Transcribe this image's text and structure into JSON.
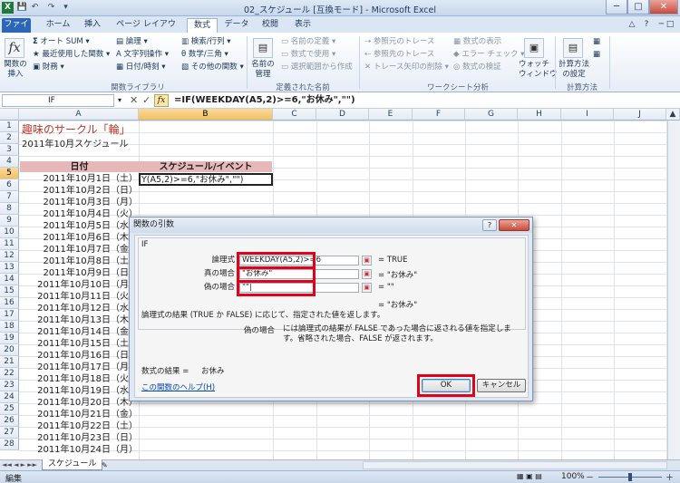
{
  "window": {
    "title": "02_スケジュール [互換モード] - Microsoft Excel",
    "controls": {
      "minimize": "─",
      "maximize": "□",
      "close": "✕"
    }
  },
  "qat": [
    "💾",
    "↶",
    "↷",
    "▾"
  ],
  "tabs": [
    "ファイル",
    "ホーム",
    "挿入",
    "ページ レイアウト",
    "数式",
    "データ",
    "校閲",
    "表示"
  ],
  "ribbon": {
    "insert_function": "関数の\n挿入",
    "library": {
      "autosum": "オート SUM",
      "recent": "最近使用した関数",
      "finance": "財務",
      "logical": "論理",
      "text": "文字列操作",
      "datetime": "日付/時刻",
      "lookup": "検索/行列",
      "math": "数学/三角",
      "other": "その他の関数",
      "group_label": "関数ライブラリ"
    },
    "names": {
      "manager": "名前の\n管理",
      "define": "名前の定義",
      "use": "数式で使用",
      "create": "選択範囲から作成",
      "group_label": "定義された名前"
    },
    "audit": {
      "trace_prec": "参照元のトレース",
      "trace_dep": "参照先のトレース",
      "remove_arrows": "トレース矢印の削除",
      "show_formulas": "数式の表示",
      "error_check": "エラー チェック",
      "evaluate": "数式の検証",
      "watch": "ウォッチ\nウィンドウ",
      "group_label": "ワークシート分析"
    },
    "calc": {
      "options": "計算方法\nの設定",
      "group_label": "計算方法"
    }
  },
  "formula_bar": {
    "name_box": "IF",
    "formula": "=IF(WEEKDAY(A5,2)>=6,\"お休み\",\"\")",
    "fx": "fx"
  },
  "columns": [
    "A",
    "B",
    "C",
    "D",
    "E",
    "F",
    "G",
    "H",
    "I",
    "J"
  ],
  "rows": [
    "1",
    "2",
    "3",
    "4",
    "5",
    "6",
    "7",
    "8",
    "9",
    "10",
    "11",
    "12",
    "13",
    "14",
    "15",
    "16",
    "17",
    "18",
    "19",
    "20",
    "21",
    "22",
    "23",
    "24",
    "25",
    "26",
    "27",
    "28"
  ],
  "sheet": {
    "title": "趣味のサークル「輪」",
    "subtitle": "2011年10月スケジュール",
    "header_date": "日付",
    "header_event": "スケジュール/イベント",
    "editing_cell": "Y(A5,2)>=6,\"お休み\",\"\")",
    "dates": [
      "2011年10月1日（土）",
      "2011年10月2日（日）",
      "2011年10月3日（月）",
      "2011年10月4日（火）",
      "2011年10月5日（水）",
      "2011年10月6日（木）",
      "2011年10月7日（金）",
      "2011年10月8日（土）",
      "2011年10月9日（日）",
      "2011年10月10日（月）",
      "2011年10月11日（火）",
      "2011年10月12日（水）",
      "2011年10月13日（木）",
      "2011年10月14日（金）",
      "2011年10月15日（土）",
      "2011年10月16日（日）",
      "2011年10月17日（月）",
      "2011年10月18日（火）",
      "2011年10月19日（水）",
      "2011年10月20日（木）",
      "2011年10月21日（金）",
      "2011年10月22日（土）",
      "2011年10月23日（日）",
      "2011年10月24日（月）"
    ]
  },
  "dialog": {
    "title": "関数の引数",
    "help_btn": "?",
    "close_btn": "✕",
    "function_name": "IF",
    "args": [
      {
        "label": "論理式",
        "value": "WEEKDAY(A5,2)>=6",
        "result": "= TRUE"
      },
      {
        "label": "真の場合",
        "value": "\"お休み\"",
        "result": "= \"お休み\""
      },
      {
        "label": "偽の場合",
        "value": "\"\"|",
        "result": "= \"\""
      }
    ],
    "overall_result": "= \"お休み\"",
    "description": "論理式の結果 (TRUE か FALSE) に応じて、指定された値を返します。",
    "arg_help_label": "偽の場合",
    "arg_help": "には論理式の結果が FALSE であった場合に返される値を指定します。省略された場合、FALSE が返されます。",
    "formula_result_label": "数式の結果 =",
    "formula_result_value": "お休み",
    "help_link": "この関数のヘルプ(H)",
    "ok": "OK",
    "cancel": "キャンセル"
  },
  "sheet_tabs": {
    "active": "スケジュール"
  },
  "status": {
    "mode": "編集",
    "zoom": "100%",
    "zoom_minus": "－",
    "zoom_plus": "＋"
  }
}
